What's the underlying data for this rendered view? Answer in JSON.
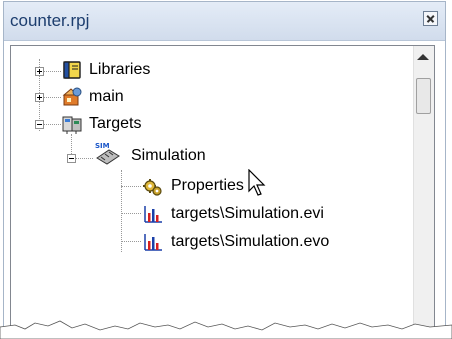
{
  "panel": {
    "title": "counter.rpj"
  },
  "tree": {
    "items": [
      {
        "label": "Libraries",
        "icon": "book-icon",
        "expander": "plus"
      },
      {
        "label": "main",
        "icon": "program-icon",
        "expander": "plus"
      },
      {
        "label": "Targets",
        "icon": "targets-icon",
        "expander": "minus"
      },
      {
        "label": "Simulation",
        "icon": "simulation-target-icon",
        "expander": "minus"
      },
      {
        "label": "Properties",
        "icon": "gears-icon",
        "expander": null
      },
      {
        "label": "targets\\Simulation.evi",
        "icon": "chart-file-icon",
        "expander": null
      },
      {
        "label": "targets\\Simulation.evo",
        "icon": "chart-file-icon",
        "expander": null
      }
    ]
  }
}
